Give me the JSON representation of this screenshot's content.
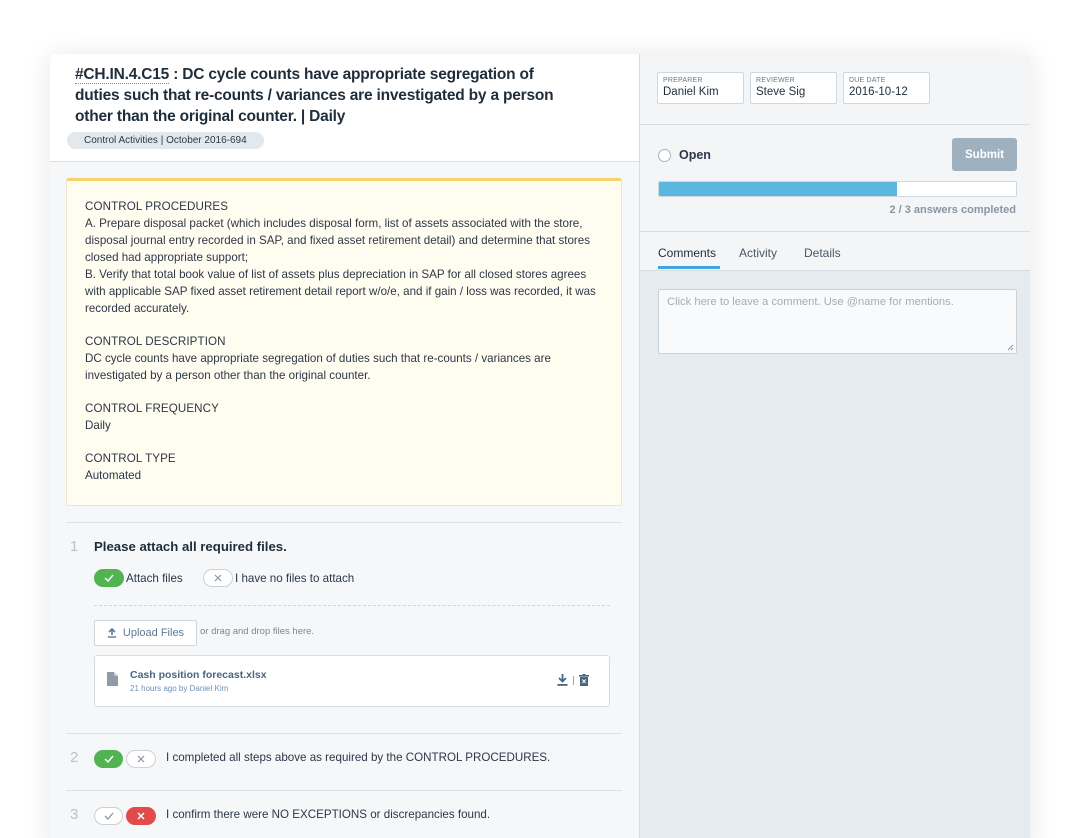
{
  "control": {
    "code": "#CH.IN.4.C15",
    "title_rest": " : DC cycle counts have appropriate segregation of duties such that re-counts / variances are investigated by a person other than the original counter. | Daily",
    "breadcrumb": "Control Activities | October 2016-694"
  },
  "procedures": {
    "procedures_title": "CONTROL PROCEDURES",
    "procedures_a": "A. Prepare disposal packet (which includes disposal form, list of assets associated with the store, disposal journal entry recorded in SAP, and fixed asset retirement detail) and determine that stores closed had appropriate support;",
    "procedures_b": "B. Verify that total book value of list of assets plus depreciation in SAP for all closed stores agrees with applicable SAP fixed asset retirement detail report w/o/e, and if gain / loss was recorded, it was recorded accurately.",
    "description_title": "CONTROL DESCRIPTION",
    "description_text": "DC cycle counts have appropriate segregation of duties such that re-counts / variances are investigated by a person other than the original counter.",
    "frequency_title": "CONTROL FREQUENCY",
    "frequency_value": "Daily",
    "type_title": "CONTROL TYPE",
    "type_value": "Automated"
  },
  "steps": {
    "step1": {
      "number": "1",
      "title": "Please attach all required files.",
      "option_attach": "Attach files",
      "option_none": "I have no files to attach",
      "upload_label": "Upload Files",
      "drag_hint": "or drag and drop files here.",
      "file": {
        "name": "Cash position forecast.xlsx",
        "meta": "21 hours ago by Daniel Kim"
      }
    },
    "step2": {
      "number": "2",
      "text": "I completed all steps above as required by the CONTROL PROCEDURES."
    },
    "step3": {
      "number": "3",
      "text": "I confirm there were NO EXCEPTIONS or discrepancies found."
    }
  },
  "meta": {
    "preparer_label": "PREPARER",
    "preparer": "Daniel Kim",
    "reviewer_label": "REVIEWER",
    "reviewer": "Steve Sig",
    "due_label": "DUE DATE",
    "due": "2016-10-12"
  },
  "status": {
    "label": "Open",
    "submit_label": "Submit",
    "progress_fraction": 0.667,
    "answers_text": "2 / 3 answers completed"
  },
  "tabs": {
    "comments": "Comments",
    "activity": "Activity",
    "details": "Details"
  },
  "comment": {
    "placeholder": "Click here to leave a comment. Use @name for mentions."
  },
  "colors": {
    "accent_blue": "#5ab8e0",
    "success_green": "#52b352",
    "danger_red": "#e14b4b",
    "highlight_yellow": "#f5d36b"
  }
}
